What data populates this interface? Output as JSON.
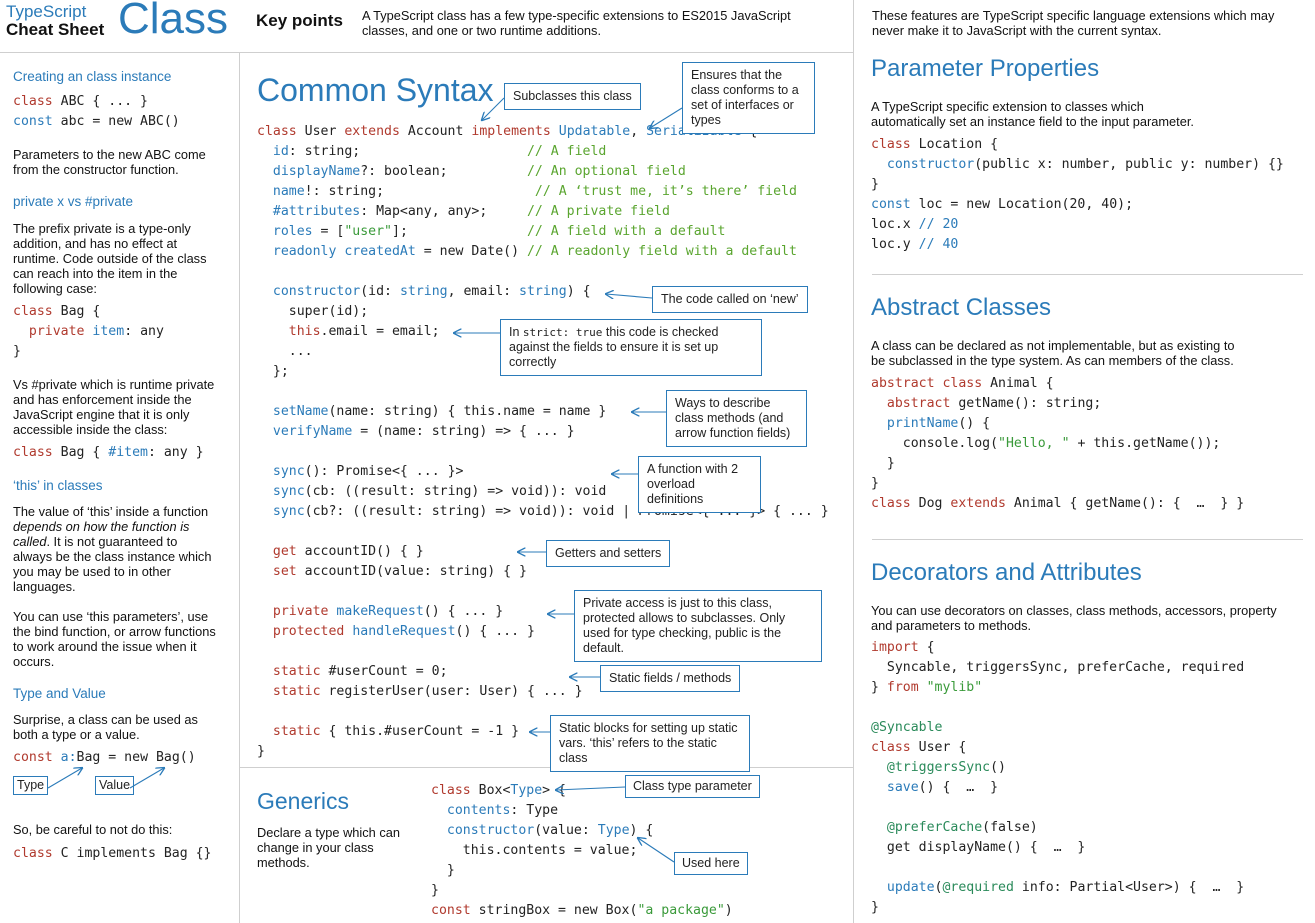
{
  "header": {
    "brand_line1": "TypeScript",
    "brand_line2": "Cheat Sheet",
    "title": "Class",
    "key_points_label": "Key points",
    "key_points_text": "A TypeScript class has a few type-specific extensions to ES2015 JavaScript classes, and one or two runtime additions.",
    "right_intro": "These features are TypeScript specific language extensions which may never make it to JavaScript with the current syntax."
  },
  "left": {
    "s1_title": "Creating an class instance",
    "s1_code_line1_kw": "class",
    "s1_code_line1_rest": " ABC { ... }",
    "s1_code_line2_kw": "const",
    "s1_code_line2_rest": " abc = new ABC()",
    "s1_text": "Parameters to the new ABC come from the constructor function.",
    "s2_title": "private x vs #private",
    "s2_text": "The prefix private is a type-only addition, and has no effect at runtime. Code outside of the class can reach into the item in the following case:",
    "s2_code_l1_kw": "class",
    "s2_code_l1_rest": " Bag {",
    "s2_code_l2_kw": "private",
    "s2_code_l2_id": "item",
    "s2_code_l2_rest": ": any",
    "s2_code_l3": "}",
    "s2_text2": "Vs #private which is runtime private and has enforcement inside the JavaScript engine that it is only accessible inside the class:",
    "s2_code2_kw": "class",
    "s2_code2_rest1": " Bag { ",
    "s2_code2_id": "#item",
    "s2_code2_rest2": ": any }",
    "s3_title": "‘this’ in classes",
    "s3_text_a": "The value of ‘this’ inside a function ",
    "s3_text_em": "depends on how the function is called",
    "s3_text_b": ". It is not guaranteed to always be the class instance which you may be used to in other languages.",
    "s3_text2": "You can use ‘this parameters’, use the bind function, or arrow functions to work around the issue when it occurs.",
    "s4_title": "Type and Value",
    "s4_text": "Surprise, a class can be used as both a type or a value.",
    "s4_code_kw": "const",
    "s4_code_id": "a:",
    "s4_code_rest": "Bag = new Bag()",
    "s4_type_label": "Type",
    "s4_value_label": "Value",
    "s4_text2": "So, be careful to not do this:",
    "s4_code2_kw": "class",
    "s4_code2_rest": " C implements Bag {}"
  },
  "middle": {
    "title": "Common Syntax",
    "callouts": {
      "subclasses": "Subclasses this class",
      "ensures": "Ensures that the class conforms to a set of interfaces or types",
      "constructor": "The code called on ‘new’",
      "strict_a": "In ",
      "strict_code": "strict: true",
      "strict_b": " this code is checked against the fields to ensure it is set up correctly",
      "methods": "Ways to describe class methods (and arrow function fields)",
      "overload": "A function with 2 overload definitions",
      "getters": "Getters and setters",
      "private": "Private access is just to this class, protected allows to subclasses. Only used for type checking, public is the default.",
      "static": "Static fields / methods",
      "static_blocks": "Static blocks for setting up static vars. ‘this’ refers to the static class"
    },
    "generics_title": "Generics",
    "generics_text": "Declare a type which can change in your class methods.",
    "generics_callout_param": "Class type parameter",
    "generics_callout_used": "Used here"
  },
  "right": {
    "pp_title": "Parameter Properties",
    "pp_text": "A TypeScript specific extension to classes which automatically set an instance field to the input parameter.",
    "ac_title": "Abstract Classes",
    "ac_text": "A class can be declared as not implementable, but as existing to be subclassed in the type system. As can members of the class.",
    "dec_title": "Decorators and Attributes",
    "dec_text": "You can use decorators on classes, class methods, accessors, property and parameters to methods."
  }
}
